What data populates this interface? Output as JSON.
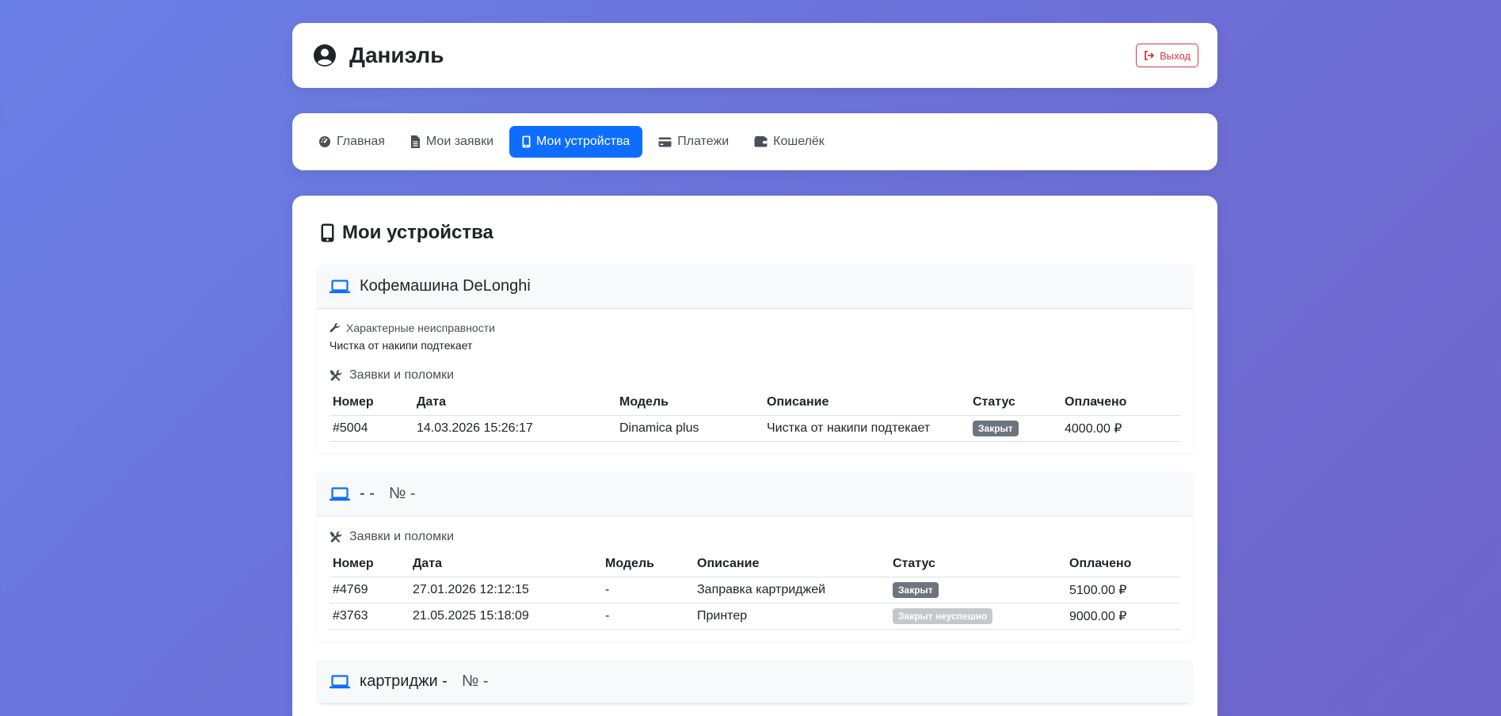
{
  "header": {
    "user_name": "Даниэль",
    "logout_label": "Выход"
  },
  "nav": {
    "items": [
      {
        "label": "Главная",
        "icon": "dashboard-icon"
      },
      {
        "label": "Мои заявки",
        "icon": "file-icon"
      },
      {
        "label": "Мои устройства",
        "icon": "mobile-icon",
        "active": true
      },
      {
        "label": "Платежи",
        "icon": "credit-card-icon"
      },
      {
        "label": "Кошелёк",
        "icon": "wallet-icon"
      }
    ]
  },
  "main": {
    "title": "Мои устройства",
    "devices": [
      {
        "name": "Кофемашина DeLonghi",
        "sub": "",
        "faults_label": "Характерные неисправности",
        "faults_text": "Чистка от накипи подтекает",
        "orders_label": "Заявки и поломки",
        "columns": [
          "Номер",
          "Дата",
          "Модель",
          "Описание",
          "Статус",
          "Оплачено"
        ],
        "rows": [
          {
            "number": "#5004",
            "date": "14.03.2026 15:26:17",
            "model": "Dinamica plus",
            "desc": "Чистка от накипи подтекает",
            "status": "Закрыт",
            "paid": "4000.00 ₽"
          }
        ]
      },
      {
        "name": "- -",
        "sub": "№ -",
        "orders_label": "Заявки и поломки",
        "columns": [
          "Номер",
          "Дата",
          "Модель",
          "Описание",
          "Статус",
          "Оплачено"
        ],
        "rows": [
          {
            "number": "#4769",
            "date": "27.01.2026 12:12:15",
            "model": "-",
            "desc": "Заправка картриджей",
            "status": "Закрыт",
            "paid": "5100.00 ₽"
          },
          {
            "number": "#3763",
            "date": "21.05.2025 15:18:09",
            "model": "-",
            "desc": "Принтер",
            "status": "Закрыт неуспешно",
            "paid": "9000.00 ₽"
          }
        ]
      },
      {
        "name": "картриджи -",
        "sub": "№ -"
      }
    ]
  },
  "colors": {
    "accent": "#0d6efd",
    "danger": "#dc3545",
    "badge_closed": "#6c757d",
    "badge_failed": "#c6c7c9"
  }
}
